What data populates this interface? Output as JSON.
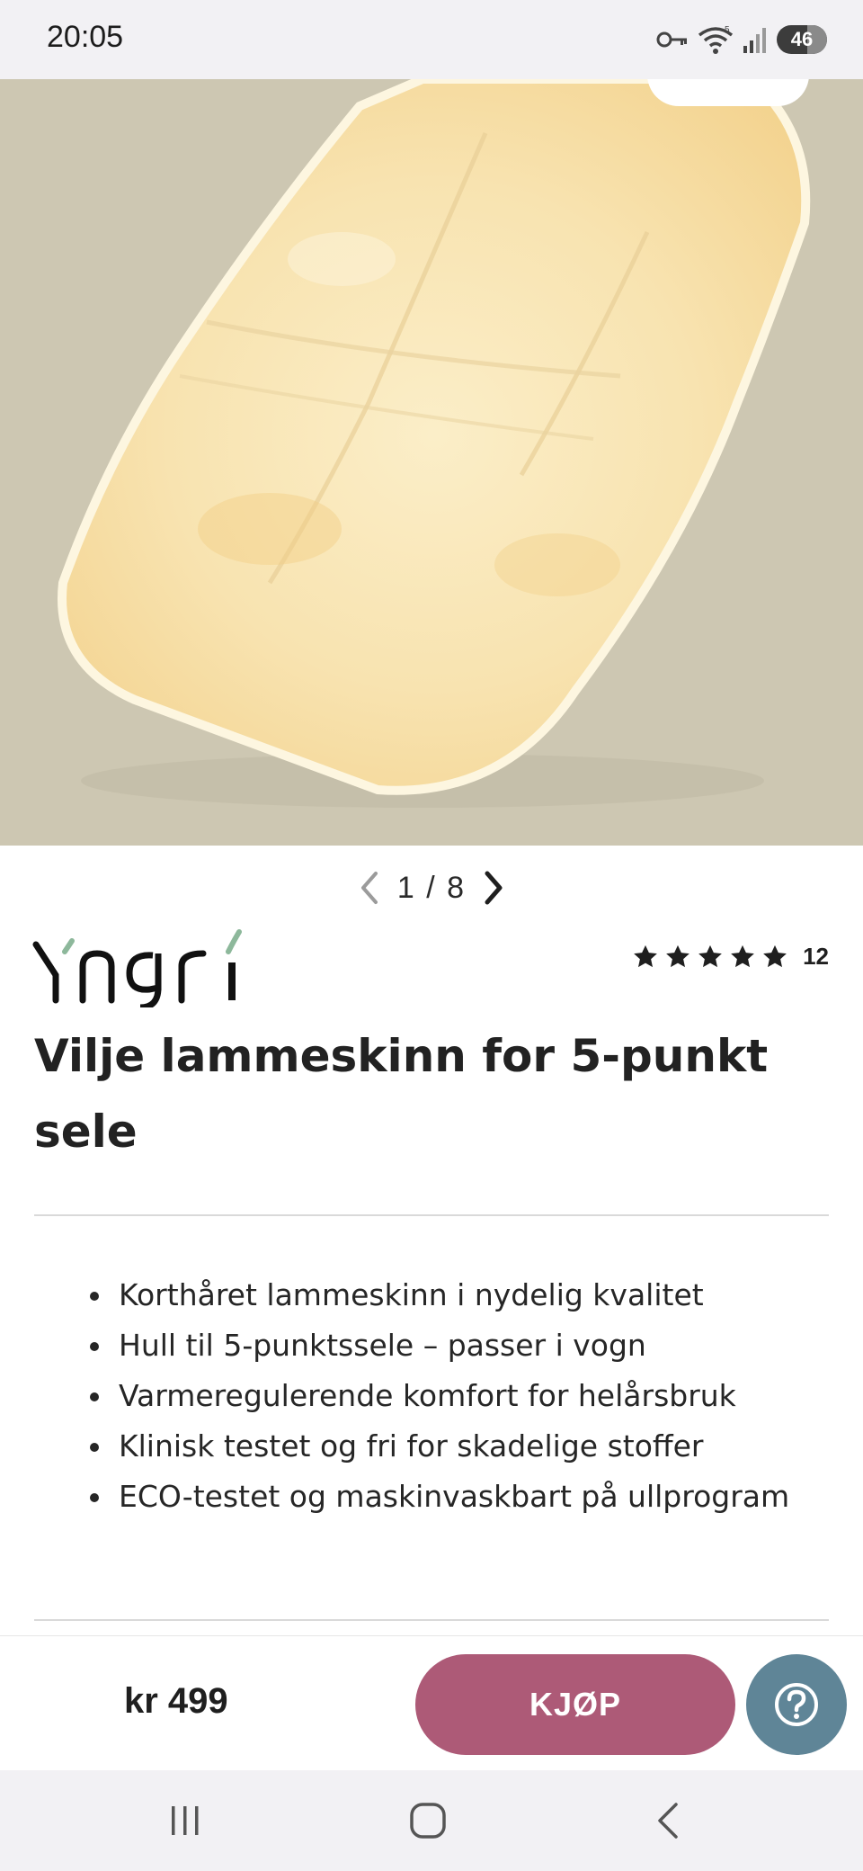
{
  "status_bar": {
    "time": "20:05",
    "battery": "46",
    "icons": [
      "key-icon",
      "wifi-icon",
      "signal-icon",
      "battery-icon"
    ]
  },
  "gallery": {
    "current": "1",
    "total": "8",
    "separator": "/",
    "counter_text": "1 / 8"
  },
  "brand": {
    "name": "Yngri"
  },
  "rating": {
    "stars": 5,
    "count": "12"
  },
  "product": {
    "title": "Vilje lammeskinn for 5-punkt sele",
    "features": [
      "Korthåret lammeskinn i nydelig kvalitet",
      "Hull til 5-punktssele – passer i vogn",
      "Varmeregulerende komfort for helårsbruk",
      "Klinisk testet og fri for skadelige stoffer",
      "ECO-testet og maskinvaskbart på ullprogram"
    ]
  },
  "buy_bar": {
    "price": "kr 499",
    "buy_label": "KJØP"
  },
  "colors": {
    "buy_button": "#ad5a77",
    "help_button": "#5f8597",
    "image_background": "#cdc7b2",
    "sheepskin": "#f8e3b0"
  }
}
